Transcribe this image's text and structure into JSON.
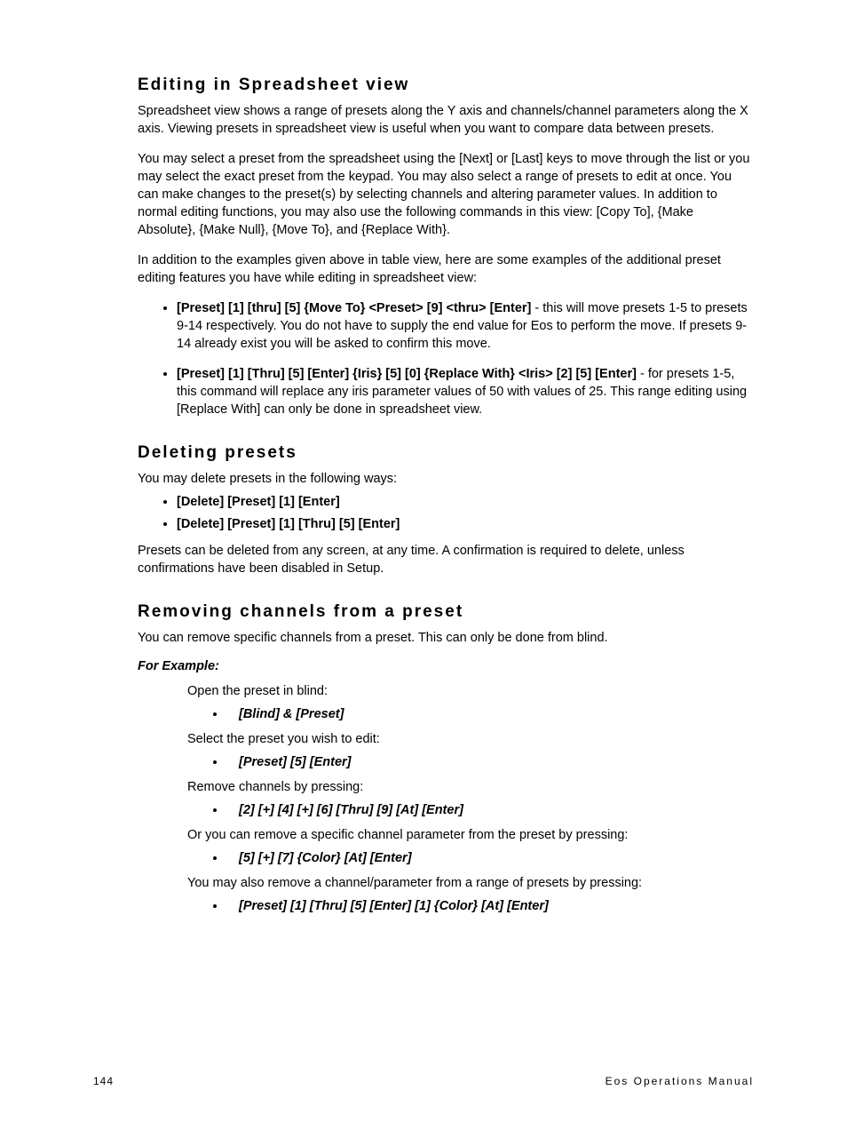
{
  "section1": {
    "heading": "Editing in Spreadsheet view",
    "p1": "Spreadsheet view shows a range of presets along the Y axis and channels/channel parameters along the X axis. Viewing presets in spreadsheet view is useful when you want to compare data between presets.",
    "p2": "You may select a preset from the spreadsheet using the [Next] or [Last] keys to move through the list or you may select the exact preset from the keypad. You may also select a range of presets to edit at once. You can make changes to the preset(s) by selecting channels and altering parameter values. In addition to normal editing functions, you may also use the following commands in this view: [Copy To], {Make Absolute}, {Make Null}, {Move To}, and {Replace With}.",
    "p3": "In addition to the examples given above in table view, here are some examples of the additional preset editing features you have while editing in spreadsheet view:",
    "li1_cmd": "[Preset] [1] [thru] [5] {Move To} <Preset> [9] <thru> [Enter]",
    "li1_rest": " - this will move presets 1-5 to presets 9-14 respectively. You do not have to supply the end value for Eos to perform the move. If presets 9-14 already exist you will be asked to confirm this move.",
    "li2_cmd": "[Preset] [1] [Thru] [5] [Enter] {Iris} [5] [0] {Replace With} <Iris> [2] [5] [Enter]",
    "li2_rest": " - for presets 1-5, this command will replace any iris parameter values of 50 with values of 25. This range editing using [Replace With] can only be done in spreadsheet view."
  },
  "section2": {
    "heading": "Deleting presets",
    "p1": "You may delete presets in the following ways:",
    "li1": "[Delete] [Preset] [1] [Enter]",
    "li2": "[Delete] [Preset] [1] [Thru] [5] [Enter]",
    "p2": "Presets can be deleted from any screen, at any time. A confirmation is required to delete, unless confirmations have been disabled in Setup."
  },
  "section3": {
    "heading": "Removing channels from a preset",
    "p1": "You can remove specific channels from a preset. This can only be done from blind.",
    "example_label": "For Example:",
    "step1": "Open the preset in blind:",
    "cmd1": "[Blind] & [Preset]",
    "step2": "Select the preset you wish to edit:",
    "cmd2": "[Preset] [5] [Enter]",
    "step3": "Remove channels by pressing:",
    "cmd3": "[2] [+] [4] [+] [6] [Thru] [9] [At] [Enter]",
    "step4": "Or you can remove a specific channel parameter from the preset by pressing:",
    "cmd4": "[5] [+] [7] {Color} [At] [Enter]",
    "step5": "You may also remove a channel/parameter from a range of presets by pressing:",
    "cmd5": "[Preset] [1] [Thru] [5] [Enter] [1] {Color} [At] [Enter]"
  },
  "footer": {
    "page": "144",
    "book": "Eos Operations Manual"
  }
}
